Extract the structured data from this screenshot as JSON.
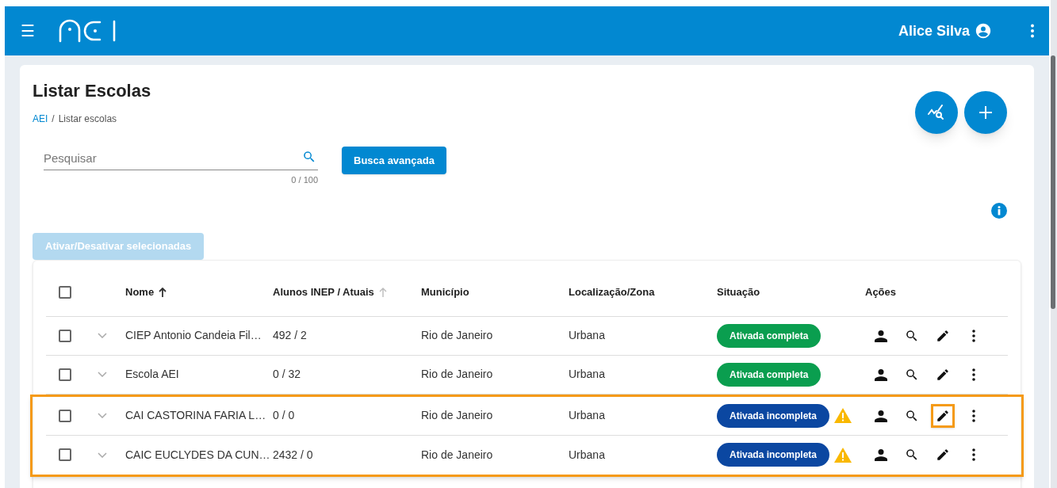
{
  "app_bar": {
    "menu": "☰",
    "user": "Alice Silva"
  },
  "page": {
    "title": "Listar Escolas",
    "breadcrumb_separator": "/",
    "breadcrumb": [
      {
        "label": "AEI",
        "link": true
      },
      {
        "label": "Listar escolas",
        "link": false
      }
    ]
  },
  "search": {
    "placeholder": "Pesquisar",
    "counter": "0 / 100"
  },
  "advanced_search_button": "Busca avançada",
  "bulk_button": {
    "label": "Ativar/Desativar selecionadas",
    "disabled": true
  },
  "table": {
    "columns": [
      {
        "label": "Nome",
        "sortable": true,
        "sorted": true
      },
      {
        "label": "Alunos INEP / Atuais",
        "sortable": true,
        "sorted": false
      },
      {
        "label": "Município",
        "sortable": false
      },
      {
        "label": "Localização/Zona",
        "sortable": false
      },
      {
        "label": "Situação",
        "sortable": false
      },
      {
        "label": "Ações",
        "sortable": false
      }
    ],
    "select_all": {
      "checked": false
    },
    "rows": [
      {
        "name": "CIEP Antonio Candeia Fil…",
        "students": "492 / 2",
        "city": "Rio de Janeiro",
        "zone": "Urbana",
        "status": "Ativada completa",
        "kind": "complete",
        "warning": false,
        "checked": false,
        "highlighted": false,
        "edit_highlighted": false,
        "disabled": false
      },
      {
        "name": "Escola AEI",
        "students": "0 / 32",
        "city": "Rio de Janeiro",
        "zone": "Urbana",
        "status": "Ativada completa",
        "kind": "complete",
        "warning": false,
        "checked": false,
        "highlighted": false,
        "edit_highlighted": false,
        "disabled": false
      },
      {
        "name": "CAI CASTORINA FARIA L…",
        "students": "0 / 0",
        "city": "Rio de Janeiro",
        "zone": "Urbana",
        "status": "Ativada incompleta",
        "kind": "incomplete",
        "warning": true,
        "checked": false,
        "highlighted": true,
        "edit_highlighted": true,
        "disabled": false
      },
      {
        "name": "CAIC EUCLYDES DA CUN…",
        "students": "2432 / 0",
        "city": "Rio de Janeiro",
        "zone": "Urbana",
        "status": "Ativada incompleta",
        "kind": "incomplete",
        "warning": true,
        "checked": false,
        "highlighted": true,
        "edit_highlighted": false,
        "disabled": false
      }
    ]
  }
}
